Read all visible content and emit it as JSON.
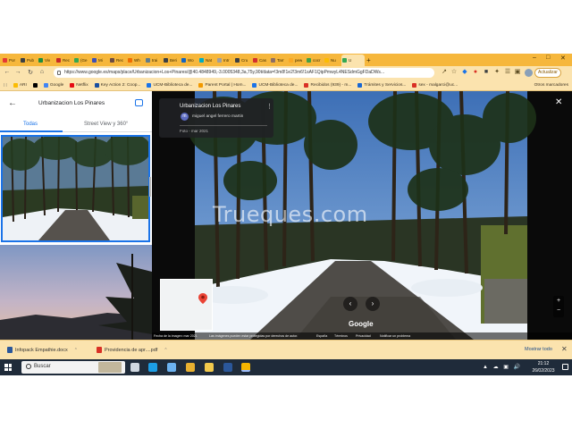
{
  "browser": {
    "tabs": [
      {
        "label": "Por",
        "color": "#e53935"
      },
      {
        "label": "Pub",
        "color": "#3c4043"
      },
      {
        "label": "Viv",
        "color": "#1e8e3e"
      },
      {
        "label": "Rec",
        "color": "#c62828"
      },
      {
        "label": "(Ge",
        "color": "#34a853"
      },
      {
        "label": "Mi",
        "color": "#3f51b5"
      },
      {
        "label": "Rec",
        "color": "#6d4c41"
      },
      {
        "label": "Wh",
        "color": "#ef6c00"
      },
      {
        "label": "trai",
        "color": "#607d8b"
      },
      {
        "label": "Beri",
        "color": "#3c4043"
      },
      {
        "label": "Wo",
        "color": "#1565c0"
      },
      {
        "label": "Nat",
        "color": "#00acc1"
      },
      {
        "label": "Intr",
        "color": "#9e9e9e"
      },
      {
        "label": "Cru",
        "color": "#3c4043"
      },
      {
        "label": "Cas",
        "color": "#d32f2f"
      },
      {
        "label": "Tarr",
        "color": "#8d6e63"
      },
      {
        "label": "pew",
        "color": "#f9a825"
      },
      {
        "label": "cocr",
        "color": "#43a047"
      },
      {
        "label": "Nu",
        "color": "#fbbc04"
      },
      {
        "label": "U",
        "color": "#34a853",
        "active": true
      }
    ],
    "new_tab": "+",
    "url": "https://www.google.es/maps/place/Urbanizacion+Los+Pinares/@40.4848949,-3.0005348,3a,75y,90t/data=!3m8!1e2!3m6!1sAF1QipPmwyL4NESdmGgFDaDWs...",
    "update_label": "Actualizar",
    "bookmarks": [
      {
        "label": "ARI",
        "color": "#fbbc04"
      },
      {
        "label": "",
        "color": "#000000"
      },
      {
        "label": "Google",
        "color": "#4285f4"
      },
      {
        "label": "Netflix",
        "color": "#e50914"
      },
      {
        "label": "Key Action 2: Coop...",
        "color": "#1a4fa0"
      },
      {
        "label": "UCM-Biblioteca de...",
        "color": "#1a73e8"
      },
      {
        "label": "Parent Portal | Hom...",
        "color": "#f29900"
      },
      {
        "label": "UCM-Biblioteca de...",
        "color": "#1a73e8"
      },
      {
        "label": "Recibidos (939) - m...",
        "color": "#d93025"
      },
      {
        "label": "Trámites y Servicios...",
        "color": "#1967d2"
      },
      {
        "label": "sex - malgarci@uc...",
        "color": "#d93025"
      }
    ],
    "other_bookmarks": "Otros marcadores"
  },
  "maps": {
    "place_title": "Urbanizacion Los Pinares",
    "tabs": [
      "Todas",
      "Street View y 360°"
    ],
    "card": {
      "title": "Urbanizacion Los Pinares",
      "author": "miguel angel ferrero martin",
      "avatar_letter": "m",
      "date": "Foto - mar 2021"
    },
    "watermark": "Trueques.com",
    "google_logo": "Google",
    "footer": {
      "credit": "Fecha de la imagen: mar 2021",
      "rights": "Las imágenes pueden estar protegidas por derechos de autor.",
      "country": "España",
      "terms": "Términos",
      "privacy": "Privacidad",
      "report": "Notificar un problema"
    }
  },
  "downloads": {
    "items": [
      {
        "name": "Infopack Empathie.docx",
        "color": "#2b579a"
      },
      {
        "name": "Providencia de apr....pdf",
        "color": "#d93025"
      }
    ],
    "show_all": "Mostrar todo"
  },
  "taskbar": {
    "search_placeholder": "Buscar",
    "time": "21:12",
    "date": "26/02/2023",
    "apps": [
      {
        "name": "task-view",
        "color": "#d0d7e0"
      },
      {
        "name": "edge",
        "color": "#1c9ee6"
      },
      {
        "name": "store",
        "color": "#6cb2f0"
      },
      {
        "name": "chrome",
        "color": "#e8b030"
      },
      {
        "name": "explorer",
        "color": "#f2c94c"
      },
      {
        "name": "word",
        "color": "#2b579a"
      },
      {
        "name": "mail",
        "color": "#cfd8dc"
      },
      {
        "name": "chrome-active",
        "color": "#f4b400"
      }
    ]
  }
}
